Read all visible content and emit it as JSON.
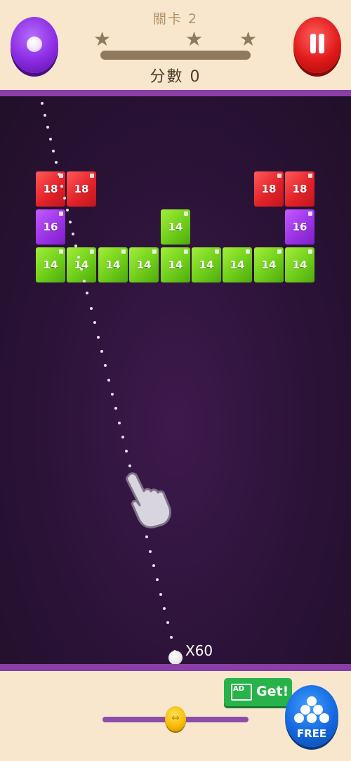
{
  "header": {
    "level_label": "關卡 2",
    "score_label": "分數 0",
    "stars_total": 3,
    "stars_earned": 0,
    "level_progress": 0
  },
  "field": {
    "ball_count": "X60",
    "blocks": [
      {
        "row": 0,
        "col": 0,
        "value": "18",
        "color": "red"
      },
      {
        "row": 0,
        "col": 1,
        "value": "18",
        "color": "red"
      },
      {
        "row": 0,
        "col": 7,
        "value": "18",
        "color": "red"
      },
      {
        "row": 0,
        "col": 8,
        "value": "18",
        "color": "red"
      },
      {
        "row": 1,
        "col": 0,
        "value": "16",
        "color": "purple"
      },
      {
        "row": 1,
        "col": 4,
        "value": "14",
        "color": "green"
      },
      {
        "row": 1,
        "col": 8,
        "value": "16",
        "color": "purple"
      },
      {
        "row": 2,
        "col": 0,
        "value": "14",
        "color": "green"
      },
      {
        "row": 2,
        "col": 1,
        "value": "14",
        "color": "green"
      },
      {
        "row": 2,
        "col": 2,
        "value": "14",
        "color": "green"
      },
      {
        "row": 2,
        "col": 3,
        "value": "14",
        "color": "green"
      },
      {
        "row": 2,
        "col": 4,
        "value": "14",
        "color": "green"
      },
      {
        "row": 2,
        "col": 5,
        "value": "14",
        "color": "green"
      },
      {
        "row": 2,
        "col": 6,
        "value": "14",
        "color": "green"
      },
      {
        "row": 2,
        "col": 7,
        "value": "14",
        "color": "green"
      },
      {
        "row": 2,
        "col": 8,
        "value": "14",
        "color": "green"
      }
    ]
  },
  "bottom": {
    "get_label": "Get!",
    "ad_label": "AD",
    "free_label": "FREE",
    "aim_slider_value": 0.5
  },
  "colors": {
    "red": "#e3232a",
    "purple": "#9c33e6",
    "green": "#6fcf1a",
    "divider": "#8a3fa6",
    "panel": "#f8e7cd"
  },
  "icons": {
    "ball_button": "ball-icon",
    "pause_button": "pause-icon",
    "star": "star-icon",
    "hand": "pointing-hand-icon",
    "ad": "film-ad-icon",
    "free_balls": "balls-icon"
  }
}
